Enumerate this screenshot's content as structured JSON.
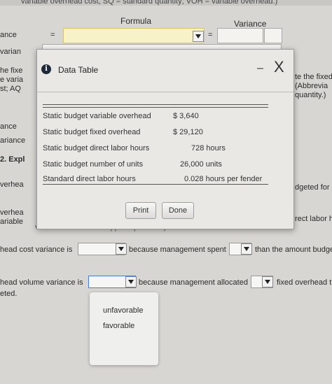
{
  "worksheet": {
    "header_note": "variable overhead cost, SQ = standard quantity; VOH = variable overhead.)",
    "formula_header": "Formula",
    "variance_header": "Variance",
    "equals_1": "=",
    "equals_2": "=",
    "left_labels": [
      "ance",
      "varian",
      "he fixe",
      "e varia",
      "st; AQ",
      "ance",
      "ariance",
      "2. Expl",
      "verhea",
      "verhea",
      "ariable"
    ],
    "right_labels": [
      "te the fixed",
      "(Abbrevia",
      "quantity.)",
      "dgeted for",
      "rect labor ho"
    ],
    "applied_note": "variable overhead is applied (incurred) based on direct labor.",
    "sentence1": {
      "start": "head cost variance is",
      "mid": "because management spent",
      "end": "than the amount budge"
    },
    "sentence2": {
      "start": "head volume variance is",
      "mid": "because management allocated",
      "end": "fixed overhead t"
    },
    "sentence2_cont": "eted."
  },
  "modal": {
    "title": "Data Table",
    "minimize_label": "–",
    "close_label": "X",
    "rows": [
      {
        "label": "Static budget variable overhead",
        "value": "$    3,640"
      },
      {
        "label": "Static budget fixed overhead",
        "value": "$  29,120"
      },
      {
        "label": "Static budget direct labor hours",
        "value": "728 hours"
      },
      {
        "label": "Static budget number of units",
        "value": "26,000 units"
      },
      {
        "label": "Standard direct labor hours",
        "value": "0.028 hours per fender"
      }
    ],
    "print_label": "Print",
    "done_label": "Done"
  },
  "dropdown": {
    "options": [
      "unfavorable",
      "favorable"
    ]
  }
}
